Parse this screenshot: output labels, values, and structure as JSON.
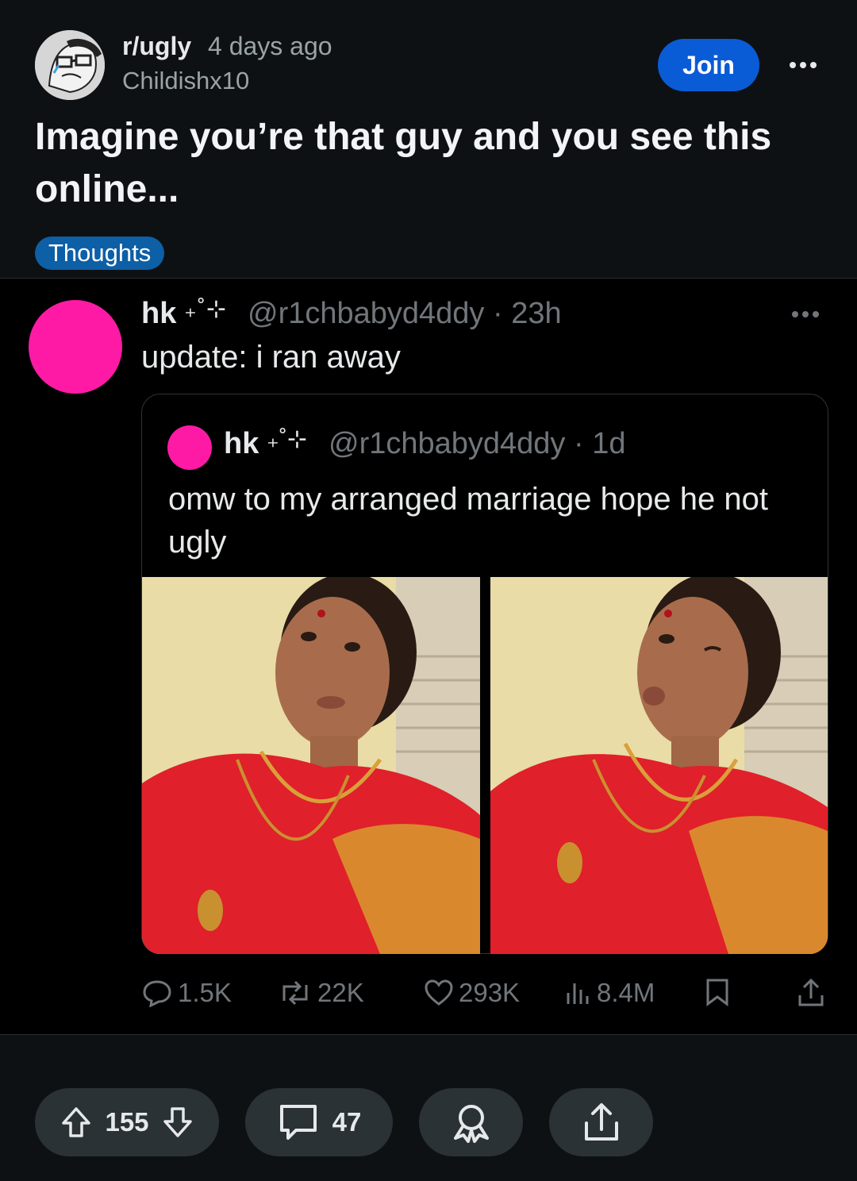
{
  "post": {
    "subreddit": "r/ugly",
    "time": "4 days ago",
    "author": "Childishx10",
    "join_label": "Join",
    "title": "Imagine you’re that guy and you see this online...",
    "flair": "Thoughts"
  },
  "tweet": {
    "name": "hk",
    "deco": "₊˚⊹",
    "handle": "@r1chbabyd4ddy · 23h",
    "text": "update: i ran away",
    "quote": {
      "name": "hk",
      "deco": "₊˚⊹",
      "handle": "@r1chbabyd4ddy · 1d",
      "text": "omw to my arranged marriage hope he not ugly"
    },
    "stats": {
      "replies": "1.5K",
      "retweets": "22K",
      "likes": "293K",
      "views": "8.4M"
    }
  },
  "bottom_bar": {
    "votes": "155",
    "comments": "47"
  },
  "colors": {
    "background": "#0e1113",
    "tweet_background": "#000000",
    "join_button": "#0a5bd6",
    "flair": "#0d5fa6",
    "avatar_pink": "#ff1aa6",
    "pill": "#2a3236"
  }
}
